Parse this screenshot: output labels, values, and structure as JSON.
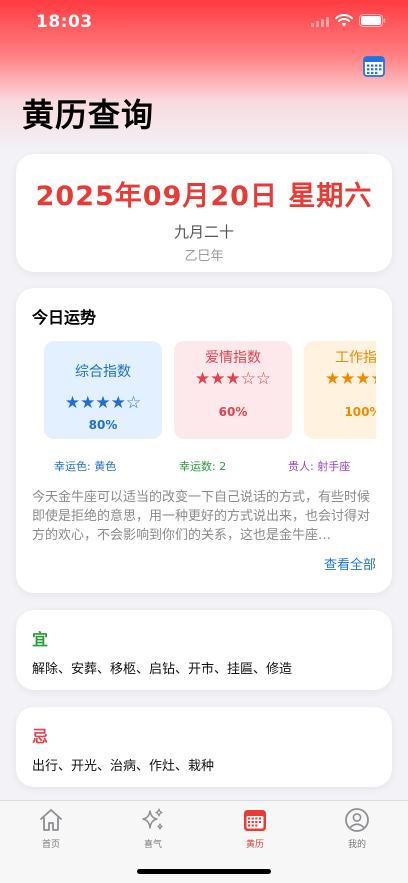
{
  "status_bar": {
    "time": "18:03"
  },
  "header": {
    "title": "黄历查询"
  },
  "date_card": {
    "date": "2025年09月20日 星期六",
    "lunar": "九月二十",
    "ganzhi": "乙巳年"
  },
  "fortune": {
    "title": "今日运势",
    "indices": [
      {
        "name": "综合指数",
        "stars": "★★★★☆",
        "rating": 4,
        "percent": "80%",
        "color": "#1e6fd0"
      },
      {
        "name": "爱情指数",
        "stars": "★★★☆☆",
        "rating": 3,
        "percent": "60%",
        "color": "#e0434f"
      },
      {
        "name": "工作指数",
        "stars": "★★★★★",
        "rating": 5,
        "percent": "100%",
        "color": "#ee8a00"
      }
    ],
    "lucky_color": "幸运色: 黄色",
    "lucky_number": "幸运数: 2",
    "noble_person": "贵人: 射手座",
    "text": "今天金牛座可以适当的改变一下自己说话的方式，有些时候即使是拒绝的意思，用一种更好的方式说出来，也会讨得对方的欢心，不会影响到你们的关系，这也是金牛座…",
    "view_all": "查看全部"
  },
  "yi": {
    "label": "宜",
    "items": "解除、安葬、移柩、启钻、开市、挂匾、修造",
    "color": "#2e9b3a"
  },
  "ji": {
    "label": "忌",
    "items": "出行、开光、治病、作灶、栽种",
    "color": "#e0434f"
  },
  "tabs": [
    {
      "label": "首页",
      "icon": "house-icon",
      "active": false
    },
    {
      "label": "喜气",
      "icon": "sparkles-icon",
      "active": false
    },
    {
      "label": "黄历",
      "icon": "calendar-icon",
      "active": true
    },
    {
      "label": "我的",
      "icon": "person-circle-icon",
      "active": false
    }
  ],
  "accent_color": "#e83b35"
}
